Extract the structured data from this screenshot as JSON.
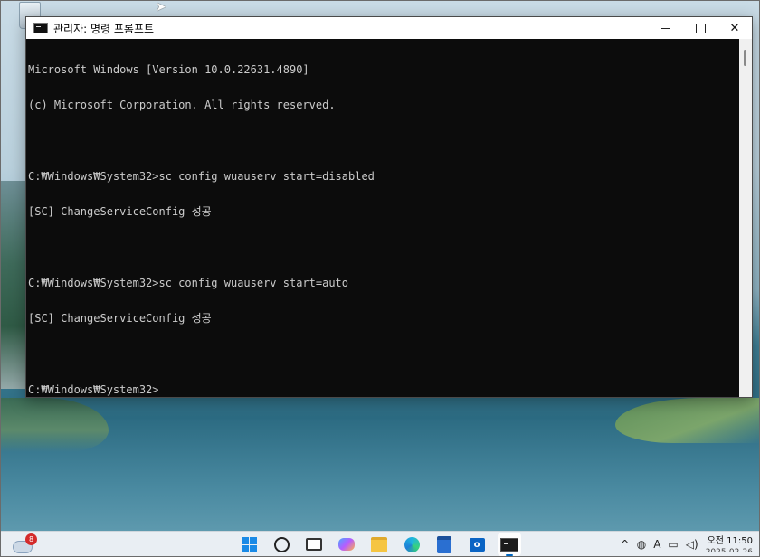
{
  "window": {
    "title": "관리자: 명령 프롬프트",
    "minimize_symbol": "—",
    "maximize_symbol": "☐",
    "close_symbol": "✕"
  },
  "console": {
    "lines": [
      "Microsoft Windows [Version 10.0.22631.4890]",
      "(c) Microsoft Corporation. All rights reserved.",
      "",
      "C:₩Windows₩System32>sc config wuauserv start=disabled",
      "[SC] ChangeServiceConfig 성공",
      "",
      "C:₩Windows₩System32>sc config wuauserv start=auto",
      "[SC] ChangeServiceConfig 성공",
      "",
      "C:₩Windows₩System32>"
    ]
  },
  "taskbar": {
    "weather_badge": "8",
    "icons": [
      "start-icon",
      "search-icon",
      "task-view-icon",
      "copilot-icon",
      "file-explorer-icon",
      "edge-icon",
      "store-icon",
      "outlook-icon",
      "terminal-icon"
    ],
    "outlook_letter": "o",
    "tray": {
      "chevron": "^",
      "ime": "A",
      "clock_label": "오전",
      "time": "11:50",
      "date": "2025-02-26"
    }
  }
}
